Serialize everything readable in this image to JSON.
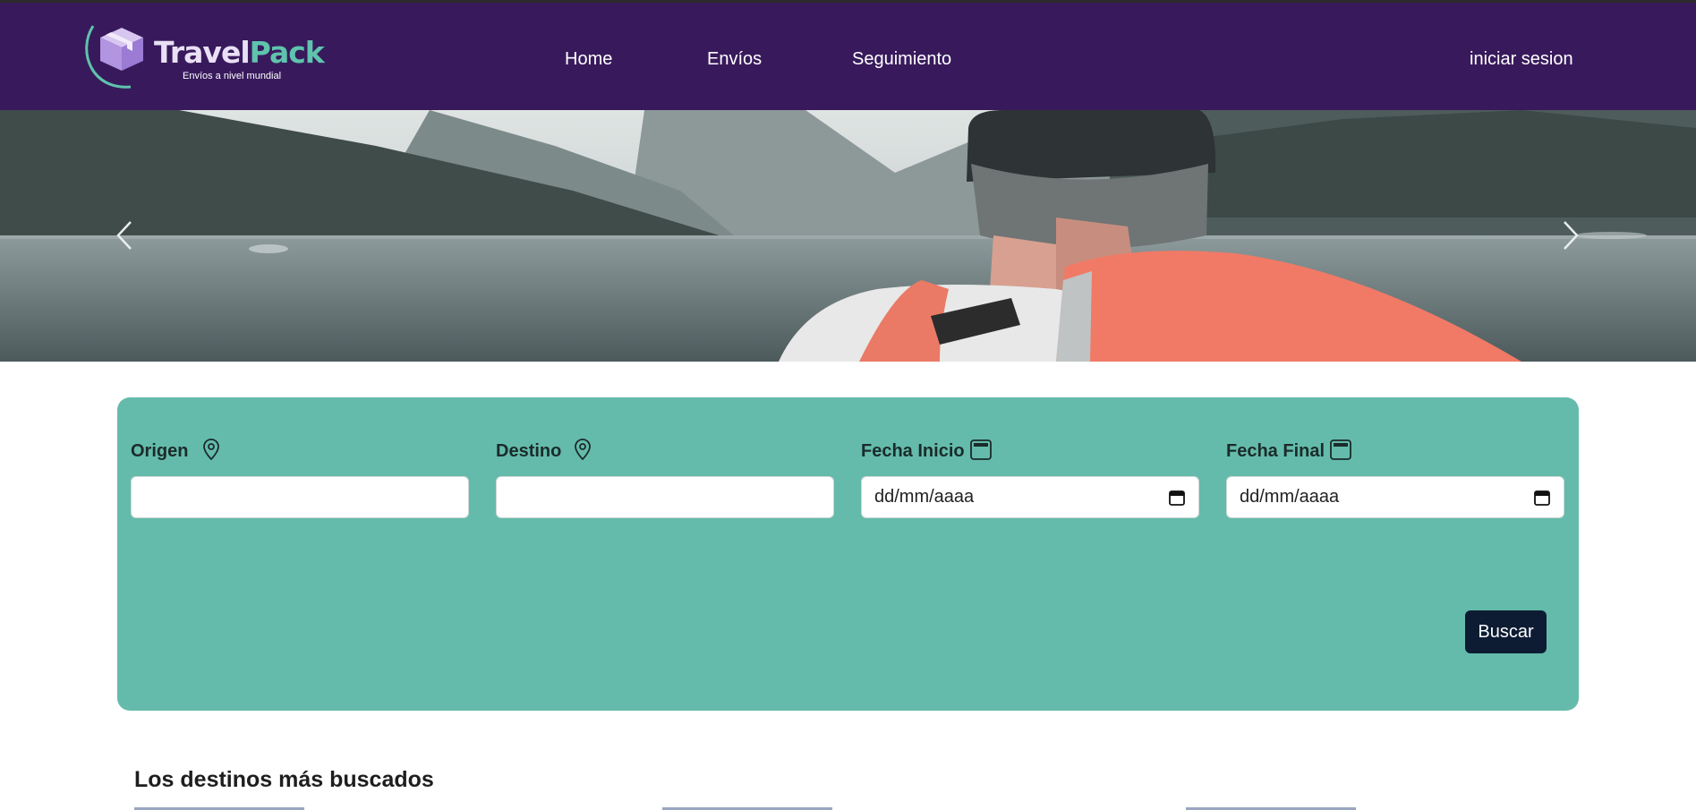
{
  "brand": {
    "name_part1": "Travel",
    "name_part2": "Pack",
    "tagline": "Envíos a nivel mundial",
    "logo_icon": "box-icon"
  },
  "nav": {
    "items": [
      {
        "label": "Home"
      },
      {
        "label": "Envíos"
      },
      {
        "label": "Seguimiento"
      }
    ],
    "login_label": "iniciar sesion"
  },
  "hero": {
    "prev_icon": "chevron-left-icon",
    "next_icon": "chevron-right-icon"
  },
  "search": {
    "fields": [
      {
        "label": "Origen",
        "icon": "location-pin-icon",
        "value": ""
      },
      {
        "label": "Destino",
        "icon": "location-pin-icon",
        "value": ""
      },
      {
        "label": "Fecha Inicio",
        "icon": "calendar-icon",
        "value": "dd/mm/aaaa"
      },
      {
        "label": "Fecha Final",
        "icon": "calendar-icon",
        "value": "dd/mm/aaaa"
      }
    ],
    "button_label": "Buscar"
  },
  "section": {
    "title": "Los destinos más buscados"
  },
  "colors": {
    "navbar": "#381a5c",
    "accent": "#64bbab",
    "button": "#0d1c33"
  }
}
